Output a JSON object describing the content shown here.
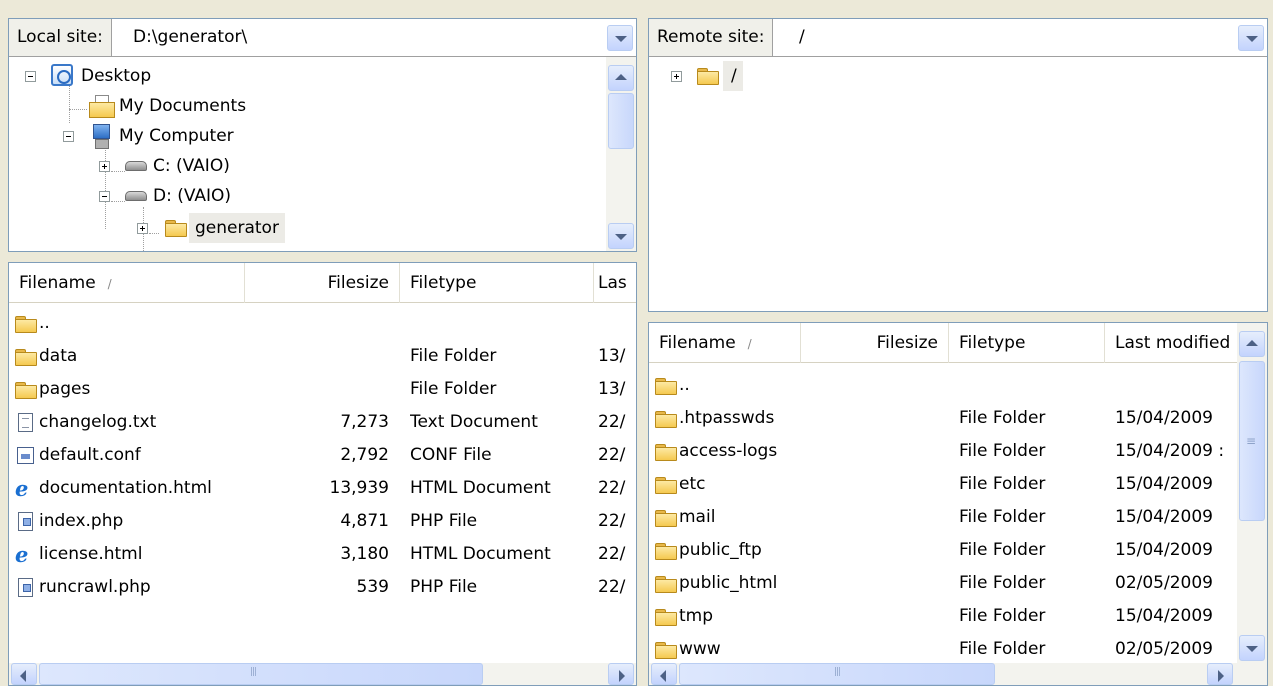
{
  "local": {
    "site_label": "Local site:",
    "site_path": "D:\\generator\\",
    "tree": [
      {
        "label": "Desktop",
        "icon": "desktop-icon",
        "expander": "minus"
      },
      {
        "label": "My Documents",
        "icon": "my-documents-icon",
        "expander": "none"
      },
      {
        "label": "My Computer",
        "icon": "my-computer-icon",
        "expander": "minus"
      },
      {
        "label": "C: (VAIO)",
        "icon": "drive-icon",
        "expander": "plus"
      },
      {
        "label": "D: (VAIO)",
        "icon": "drive-icon",
        "expander": "minus"
      },
      {
        "label": "generator",
        "icon": "folder-icon",
        "expander": "plus",
        "selected": true
      }
    ],
    "columns": {
      "filename": "Filename",
      "sort": "/",
      "filesize": "Filesize",
      "filetype": "Filetype",
      "last": "Las"
    },
    "files": [
      {
        "name": "..",
        "size": "",
        "type": "",
        "date": "",
        "icon": "folder-icon"
      },
      {
        "name": "data",
        "size": "",
        "type": "File Folder",
        "date": "13/",
        "icon": "folder-icon"
      },
      {
        "name": "pages",
        "size": "",
        "type": "File Folder",
        "date": "13/",
        "icon": "folder-icon"
      },
      {
        "name": "changelog.txt",
        "size": "7,273",
        "type": "Text Document",
        "date": "22/",
        "icon": "text-file-icon"
      },
      {
        "name": "default.conf",
        "size": "2,792",
        "type": "CONF File",
        "date": "22/",
        "icon": "conf-file-icon"
      },
      {
        "name": "documentation.html",
        "size": "13,939",
        "type": "HTML Document",
        "date": "22/",
        "icon": "ie-html-icon"
      },
      {
        "name": "index.php",
        "size": "4,871",
        "type": "PHP File",
        "date": "22/",
        "icon": "php-file-icon"
      },
      {
        "name": "license.html",
        "size": "3,180",
        "type": "HTML Document",
        "date": "22/",
        "icon": "ie-html-icon"
      },
      {
        "name": "runcrawl.php",
        "size": "539",
        "type": "PHP File",
        "date": "22/",
        "icon": "php-file-icon"
      }
    ]
  },
  "remote": {
    "site_label": "Remote site:",
    "site_path": "/",
    "tree": [
      {
        "label": "/",
        "icon": "folder-icon",
        "expander": "plus"
      }
    ],
    "columns": {
      "filename": "Filename",
      "sort": "/",
      "filesize": "Filesize",
      "filetype": "Filetype",
      "last": "Last modified"
    },
    "files": [
      {
        "name": "..",
        "type": "",
        "date": ""
      },
      {
        "name": ".htpasswds",
        "type": "File Folder",
        "date": "15/04/2009"
      },
      {
        "name": "access-logs",
        "type": "File Folder",
        "date": "15/04/2009 :"
      },
      {
        "name": "etc",
        "type": "File Folder",
        "date": "15/04/2009"
      },
      {
        "name": "mail",
        "type": "File Folder",
        "date": "15/04/2009"
      },
      {
        "name": "public_ftp",
        "type": "File Folder",
        "date": "15/04/2009"
      },
      {
        "name": "public_html",
        "type": "File Folder",
        "date": "02/05/2009"
      },
      {
        "name": "tmp",
        "type": "File Folder",
        "date": "15/04/2009"
      },
      {
        "name": "www",
        "type": "File Folder",
        "date": "02/05/2009"
      }
    ]
  },
  "scroll_grip": "|||",
  "colors": {
    "panel_border": "#7f9db9",
    "window_bg": "#ece9d8",
    "selection": "#ecebe6",
    "scroll_button": "#c3d3fd"
  }
}
